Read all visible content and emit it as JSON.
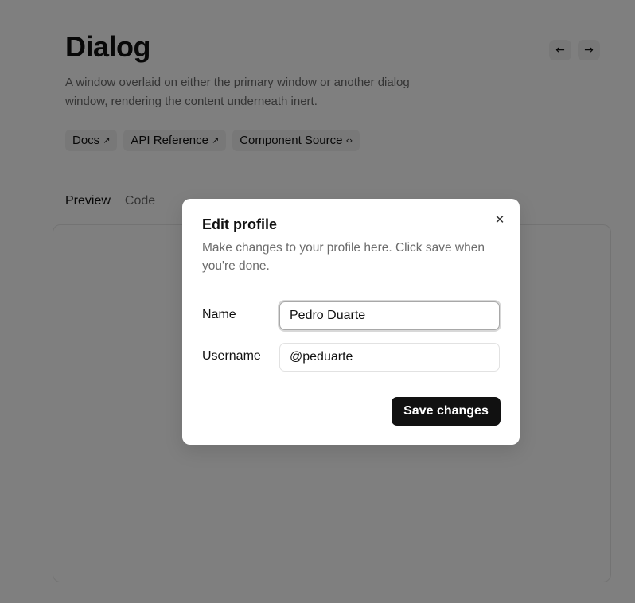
{
  "page": {
    "title": "Dialog",
    "description": "A window overlaid on either the primary window or another dialog window, rendering the content underneath inert.",
    "nav": {
      "prev_icon": "←",
      "next_icon": "→"
    },
    "badges": [
      {
        "label": "Docs",
        "icon": "↗"
      },
      {
        "label": "API Reference",
        "icon": "↗"
      },
      {
        "label": "Component Source",
        "icon": "‹›"
      }
    ],
    "tabs": [
      {
        "label": "Preview",
        "active": true
      },
      {
        "label": "Code",
        "active": false
      }
    ]
  },
  "dialog": {
    "title": "Edit profile",
    "description": "Make changes to your profile here. Click save when you're done.",
    "close_icon": "✕",
    "fields": [
      {
        "label": "Name",
        "value": "Pedro Duarte",
        "focused": true
      },
      {
        "label": "Username",
        "value": "@peduarte",
        "focused": false
      }
    ],
    "save_label": "Save changes"
  },
  "colors": {
    "overlay": "rgba(0,0,0,0.5)",
    "primary_button": "#111111",
    "muted_text": "#6b6b6b",
    "badge_bg": "#f1f1f1"
  }
}
